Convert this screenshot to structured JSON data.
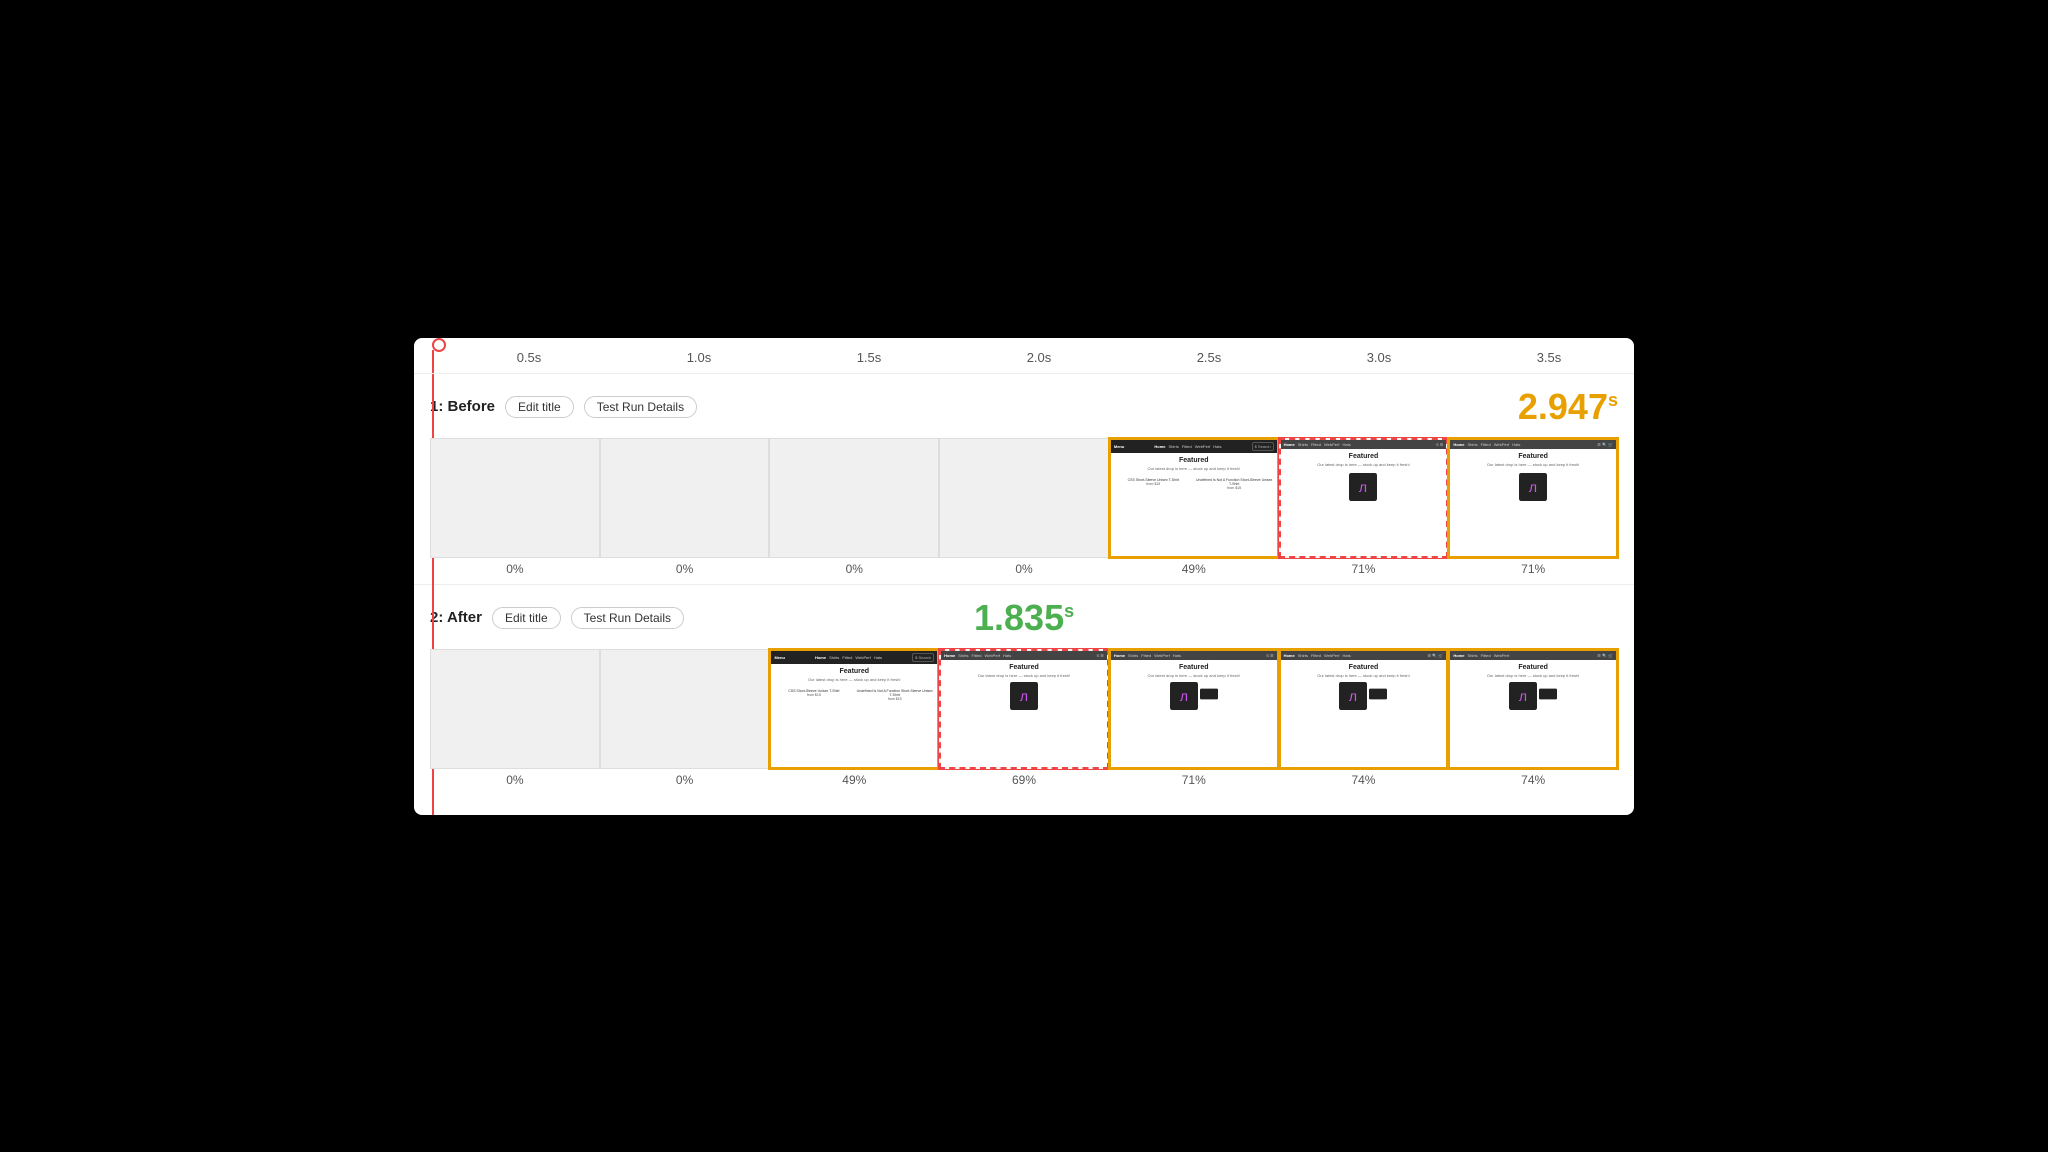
{
  "timeline": {
    "labels": [
      "0.5s",
      "1.0s",
      "1.5s",
      "2.0s",
      "2.5s",
      "3.0s",
      "3.5s"
    ]
  },
  "before": {
    "section_label": "1: Before",
    "edit_title_btn": "Edit title",
    "test_run_btn": "Test Run Details",
    "score": "2.947",
    "score_unit": "s",
    "frames": [
      {
        "pct": "0%",
        "type": "empty"
      },
      {
        "pct": "0%",
        "type": "empty"
      },
      {
        "pct": "0%",
        "type": "empty"
      },
      {
        "pct": "0%",
        "type": "empty"
      },
      {
        "pct": "49%",
        "type": "content",
        "highlight": "orange"
      },
      {
        "pct": "71%",
        "type": "content",
        "highlight": "red"
      },
      {
        "pct": "71%",
        "type": "content",
        "highlight": "orange"
      }
    ]
  },
  "after": {
    "section_label": "2: After",
    "edit_title_btn": "Edit title",
    "test_run_btn": "Test Run Details",
    "score": "1.835",
    "score_unit": "s",
    "frames": [
      {
        "pct": "0%",
        "type": "empty"
      },
      {
        "pct": "0%",
        "type": "empty"
      },
      {
        "pct": "49%",
        "type": "content",
        "highlight": "orange"
      },
      {
        "pct": "69%",
        "type": "content",
        "highlight": "red"
      },
      {
        "pct": "71%",
        "type": "content",
        "highlight": "orange"
      },
      {
        "pct": "74%",
        "type": "content",
        "highlight": "orange"
      },
      {
        "pct": "74%",
        "type": "content",
        "highlight": "orange"
      }
    ]
  }
}
